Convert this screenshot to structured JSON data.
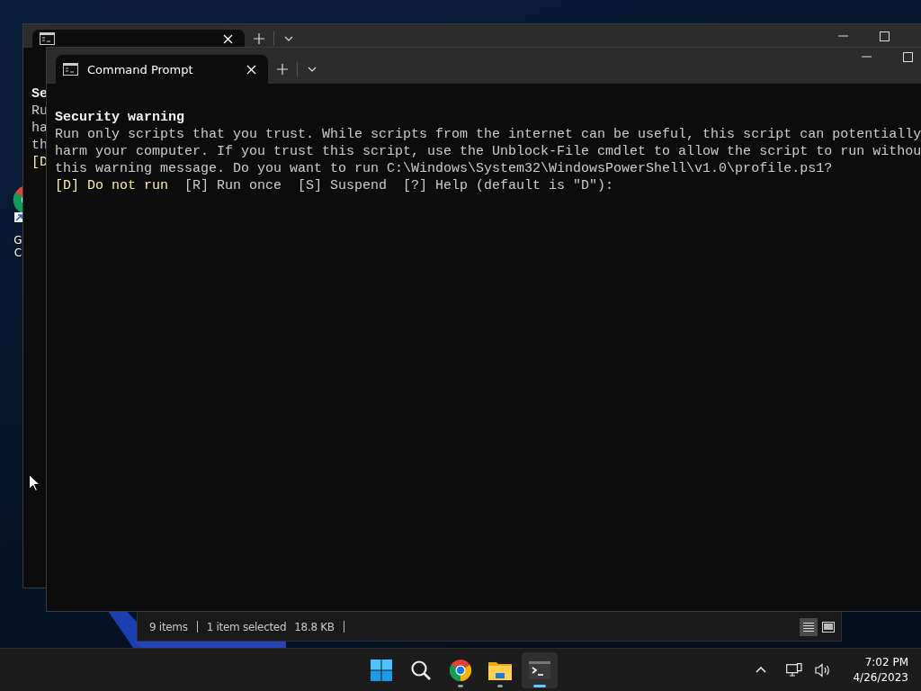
{
  "desktop_icon": {
    "label_lines": [
      "G",
      "C"
    ]
  },
  "background_window": {
    "lines": [
      {
        "kind": "heading",
        "segments": [
          {
            "text": "Se",
            "highlighted": false
          }
        ]
      },
      {
        "kind": "body",
        "segments": [
          {
            "text": "Ru",
            "highlighted": false
          }
        ]
      },
      {
        "kind": "body",
        "segments": [
          {
            "text": "ha",
            "highlighted": false
          }
        ]
      },
      {
        "kind": "body",
        "segments": [
          {
            "text": "th",
            "highlighted": false
          }
        ]
      },
      {
        "kind": "body",
        "segments": [
          {
            "text": "[D",
            "highlighted": true
          }
        ]
      }
    ]
  },
  "explorer_status": {
    "item_count": "9 items",
    "selection": "1 item selected",
    "size": "18.8 KB"
  },
  "terminal": {
    "tab_title": "Command Prompt",
    "lines": [
      {
        "kind": "heading",
        "segments": [
          {
            "text": "Security warning",
            "highlighted": false
          }
        ]
      },
      {
        "kind": "body",
        "segments": [
          {
            "text": "Run only scripts that you trust. While scripts from the internet can be useful, this script can potentially",
            "highlighted": false
          }
        ]
      },
      {
        "kind": "body",
        "segments": [
          {
            "text": "harm your computer. If you trust this script, use the Unblock-File cmdlet to allow the script to run withou",
            "highlighted": false
          }
        ]
      },
      {
        "kind": "body",
        "segments": [
          {
            "text": "this warning message. Do you want to run C:\\Windows\\System32\\WindowsPowerShell\\v1.0\\profile.ps1?",
            "highlighted": false
          }
        ]
      },
      {
        "kind": "body",
        "segments": [
          {
            "text": "[D] Do not run",
            "highlighted": true
          },
          {
            "text": "  [R] Run once  [S] Suspend  [?] Help (default is \"D\"):",
            "highlighted": false
          }
        ]
      }
    ]
  },
  "taskbar": {
    "apps": [
      {
        "kind": "start",
        "running": false,
        "selected": false
      },
      {
        "kind": "search",
        "running": false,
        "selected": false
      },
      {
        "kind": "chrome",
        "running": true,
        "selected": false
      },
      {
        "kind": "explorer",
        "running": true,
        "selected": false
      },
      {
        "kind": "terminal",
        "running": true,
        "selected": true
      }
    ],
    "clock": {
      "time": "7:02 PM",
      "date": "4/26/2023"
    }
  }
}
